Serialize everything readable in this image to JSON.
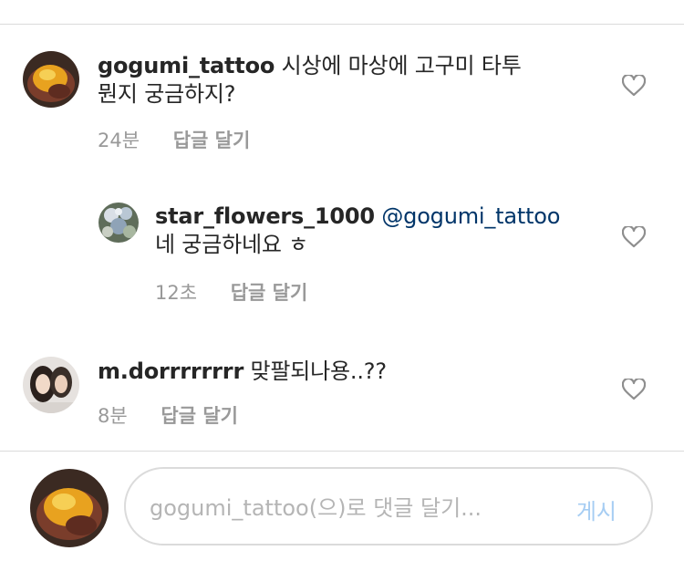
{
  "comments": [
    {
      "username": "gogumi_tattoo",
      "text": "시상에 마상에 고구미 타투",
      "text_line2": "뭔지 궁금하지?",
      "time": "24분",
      "reply_label": "답글 달기"
    },
    {
      "username": "star_flowers_1000",
      "mention": "@gogumi_tattoo",
      "text": "네 궁금하네요 ㅎ",
      "time": "12초",
      "reply_label": "답글 달기"
    },
    {
      "username": "m.dorrrrrrrr",
      "text": "맞팔되나용..??",
      "time": "8분",
      "reply_label": "답글 달기"
    }
  ],
  "composer": {
    "placeholder": "gogumi_tattoo(으)로 댓글 달기...",
    "post_label": "게시"
  },
  "colors": {
    "username": "#262626",
    "mention": "#003569",
    "meta": "#999999",
    "post_button": "#a6cdf3",
    "divider": "#dbdbdb"
  }
}
